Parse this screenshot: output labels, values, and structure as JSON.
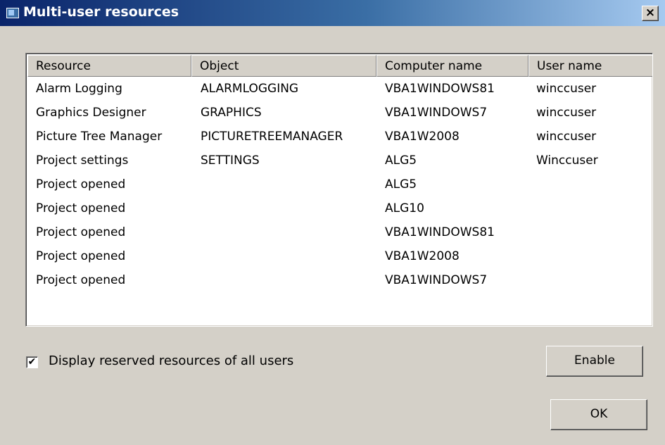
{
  "window": {
    "title": "Multi-user resources",
    "close_glyph": "×"
  },
  "table": {
    "columns": [
      "Resource",
      "Object",
      "Computer name",
      "User name"
    ],
    "rows": [
      [
        "Alarm Logging",
        "ALARMLOGGING",
        "VBA1WINDOWS81",
        "winccuser"
      ],
      [
        "Graphics Designer",
        "GRAPHICS",
        "VBA1WINDOWS7",
        "winccuser"
      ],
      [
        "Picture Tree Manager",
        "PICTURETREEMANAGER",
        "VBA1W2008",
        "winccuser"
      ],
      [
        "Project settings",
        "SETTINGS",
        "ALG5",
        "Winccuser"
      ],
      [
        "Project opened",
        "",
        "ALG5",
        ""
      ],
      [
        "Project opened",
        "",
        "ALG10",
        ""
      ],
      [
        "Project opened",
        "",
        "VBA1WINDOWS81",
        ""
      ],
      [
        "Project opened",
        "",
        "VBA1W2008",
        ""
      ],
      [
        "Project opened",
        "",
        "VBA1WINDOWS7",
        ""
      ]
    ]
  },
  "scrollbar": {
    "left_arrow": "◀",
    "right_arrow": "▶"
  },
  "options": {
    "show_all_label": "Display reserved resources of all users",
    "show_all_checked": true,
    "check_glyph": "✔"
  },
  "buttons": {
    "enable": "Enable",
    "ok": "OK"
  }
}
